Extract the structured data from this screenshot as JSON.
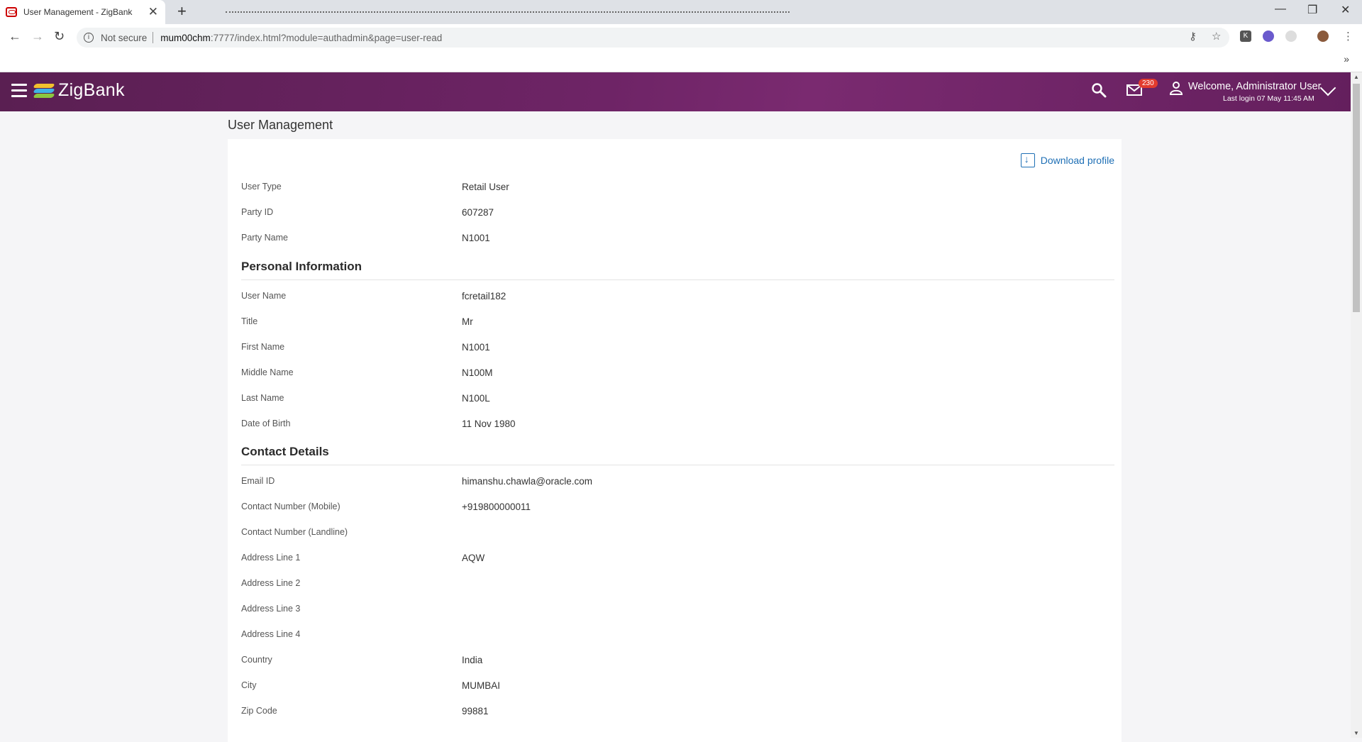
{
  "browser": {
    "tab_title": "User Management - ZigBank",
    "tab_close": "✕",
    "new_tab": "+",
    "not_secure": "Not secure",
    "url_host": "mum00chm",
    "url_path": ":7777/index.html?module=authadmin&page=user-read",
    "ext_k": "K",
    "bookmarks_overflow": "»"
  },
  "header": {
    "brand": "ZigBank",
    "badge_count": "230",
    "welcome": "Welcome, Administrator User",
    "last_login": "Last login 07 May 11:45 AM"
  },
  "page": {
    "title": "User Management",
    "download_label": "Download profile",
    "basic": [
      {
        "label": "User Type",
        "value": "Retail User"
      },
      {
        "label": "Party ID",
        "value": "607287"
      },
      {
        "label": "Party Name",
        "value": "N1001"
      }
    ],
    "personal_heading": "Personal Information",
    "personal": [
      {
        "label": "User Name",
        "value": "fcretail182"
      },
      {
        "label": "Title",
        "value": "Mr"
      },
      {
        "label": "First Name",
        "value": "N1001"
      },
      {
        "label": "Middle Name",
        "value": "N100M"
      },
      {
        "label": "Last Name",
        "value": "N100L"
      },
      {
        "label": "Date of Birth",
        "value": "11 Nov 1980"
      }
    ],
    "contact_heading": "Contact Details",
    "contact": [
      {
        "label": "Email ID",
        "value": "himanshu.chawla@oracle.com"
      },
      {
        "label": "Contact Number (Mobile)",
        "value": "+919800000011"
      },
      {
        "label": "Contact Number (Landline)",
        "value": ""
      },
      {
        "label": "Address Line 1",
        "value": "AQW"
      },
      {
        "label": "Address Line 2",
        "value": ""
      },
      {
        "label": "Address Line 3",
        "value": ""
      },
      {
        "label": "Address Line 4",
        "value": ""
      },
      {
        "label": "Country",
        "value": "India"
      },
      {
        "label": "City",
        "value": "MUMBAI"
      },
      {
        "label": "Zip Code",
        "value": "99881"
      }
    ]
  },
  "colors": {
    "header_bg": "#6e2466",
    "link": "#1e6fb5",
    "badge": "#e23b2e"
  }
}
